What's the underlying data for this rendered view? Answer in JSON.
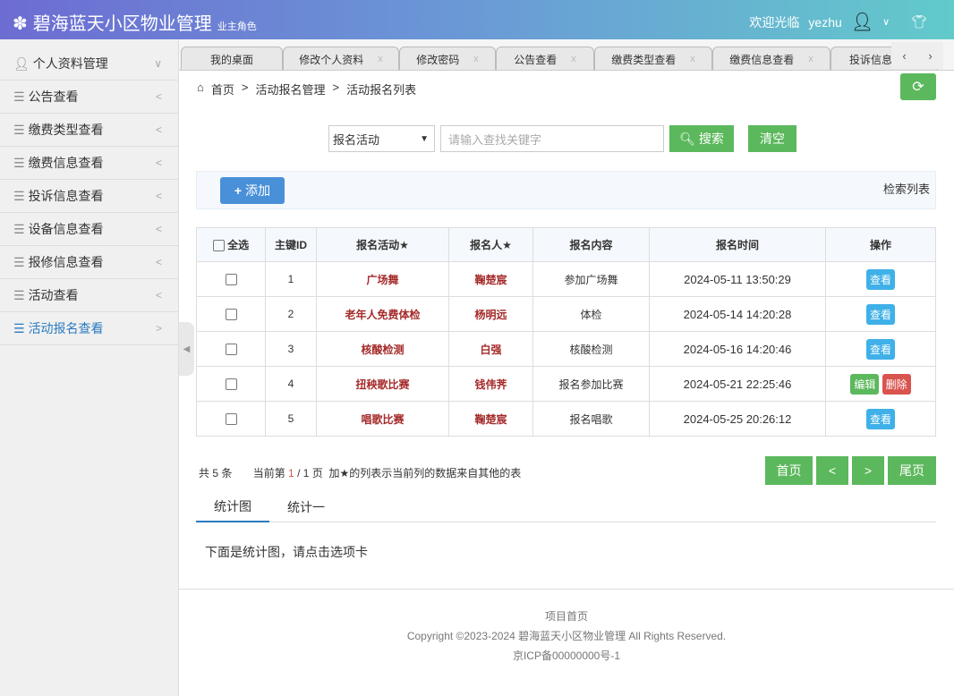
{
  "header": {
    "title": "碧海蓝天小区物业管理",
    "role": "业主角色",
    "welcome": "欢迎光临",
    "username": "yezhu"
  },
  "sidebar": {
    "items": [
      {
        "label": "个人资料管理"
      },
      {
        "label": "公告查看"
      },
      {
        "label": "缴费类型查看"
      },
      {
        "label": "缴费信息查看"
      },
      {
        "label": "投诉信息查看"
      },
      {
        "label": "设备信息查看"
      },
      {
        "label": "报修信息查看"
      },
      {
        "label": "活动查看"
      },
      {
        "label": "活动报名查看"
      }
    ]
  },
  "tabs": [
    {
      "label": "我的桌面"
    },
    {
      "label": "修改个人资料"
    },
    {
      "label": "修改密码"
    },
    {
      "label": "公告查看"
    },
    {
      "label": "缴费类型查看"
    },
    {
      "label": "缴费信息查看"
    },
    {
      "label": "投诉信息"
    }
  ],
  "tab_close": "x",
  "breadcrumb": [
    "首页",
    "活动报名管理",
    "活动报名列表"
  ],
  "search": {
    "field": "报名活动",
    "placeholder": "请输入查找关键字",
    "search_label": "搜索",
    "clear_label": "清空"
  },
  "panel": {
    "add_label": "添加",
    "title": "检索列表"
  },
  "table": {
    "headers": [
      "全选",
      "主键ID",
      "报名活动★",
      "报名人★",
      "报名内容",
      "报名时间",
      "操作"
    ],
    "rows": [
      {
        "id": "1",
        "activity": "广场舞",
        "person": "鞠楚宸",
        "content": "参加广场舞",
        "time": "2024-05-11 13:50:29",
        "actions": [
          "查看"
        ]
      },
      {
        "id": "2",
        "activity": "老年人免费体检",
        "person": "杨明远",
        "content": "体检",
        "time": "2024-05-14 14:20:28",
        "actions": [
          "查看"
        ]
      },
      {
        "id": "3",
        "activity": "核酸检测",
        "person": "白强",
        "content": "核酸检测",
        "time": "2024-05-16 14:20:46",
        "actions": [
          "查看"
        ]
      },
      {
        "id": "4",
        "activity": "扭秧歌比赛",
        "person": "钱伟荠",
        "content": "报名参加比赛",
        "time": "2024-05-21 22:25:46",
        "actions": [
          "编辑",
          "删除"
        ]
      },
      {
        "id": "5",
        "activity": "唱歌比赛",
        "person": "鞠楚宸",
        "content": "报名唱歌",
        "time": "2024-05-25 20:26:12",
        "actions": [
          "查看"
        ]
      }
    ]
  },
  "pagination": {
    "total_text": "共 5 条",
    "current_prefix": "当前第",
    "current": "1",
    "total_pages": "/ 1 页",
    "note": "加★的列表示当前列的数据来自其他的表",
    "first": "首页",
    "prev": "<",
    "next": ">",
    "last": "尾页"
  },
  "content_tabs": [
    {
      "label": "统计图"
    },
    {
      "label": "统计一"
    }
  ],
  "content_text": "下面是统计图，请点击选项卡",
  "footer": {
    "link": "项目首页",
    "copyright": "Copyright ©2023-2024 碧海蓝天小区物业管理 All Rights Reserved.",
    "icp": "京ICP备00000000号-1"
  }
}
